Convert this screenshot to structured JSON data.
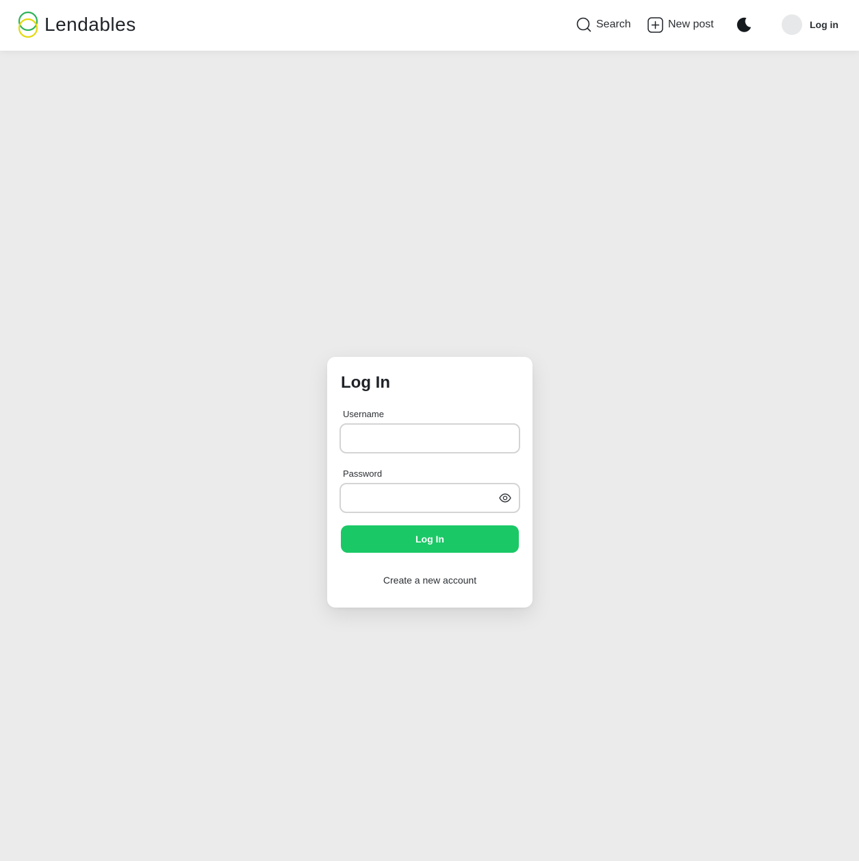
{
  "header": {
    "brand": "Lendables",
    "search_label": "Search",
    "new_post_label": "New post",
    "login_label": "Log in",
    "icons": {
      "logo": "overlapping-circles-logo-icon",
      "search": "search-icon",
      "new_post": "plus-square-icon",
      "theme": "moon-icon"
    }
  },
  "login_form": {
    "title": "Log In",
    "username_label": "Username",
    "username_value": "",
    "password_label": "Password",
    "password_value": "",
    "submit_label": "Log In",
    "create_account_label": "Create a new account",
    "password_toggle_icon": "eye-icon"
  },
  "colors": {
    "accent": "#1bc866",
    "logo_green": "#2fb35a",
    "logo_yellow": "#e3d90f",
    "background": "#ebebeb",
    "header_bg": "#ffffff"
  }
}
